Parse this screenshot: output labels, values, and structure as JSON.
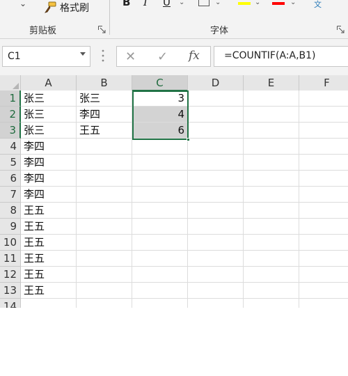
{
  "ribbon": {
    "format_painter_label": "格式刷",
    "clipboard_group_label": "剪贴板",
    "font_group_label": "字体",
    "bold_label": "B",
    "italic_label": "I",
    "underline_label": "U",
    "wen_label": "文",
    "highlight_color": "#ffff00",
    "font_color": "#ff0000"
  },
  "formula_bar": {
    "name_box": "C1",
    "formula": "=COUNTIF(A:A,B1)"
  },
  "sheet": {
    "columns": [
      "A",
      "B",
      "C",
      "D",
      "E",
      "F"
    ],
    "selected_column": "C",
    "rows": [
      {
        "n": "1",
        "A": "张三",
        "B": "张三",
        "C": "3"
      },
      {
        "n": "2",
        "A": "张三",
        "B": "李四",
        "C": "4"
      },
      {
        "n": "3",
        "A": "张三",
        "B": "王五",
        "C": "6"
      },
      {
        "n": "4",
        "A": "李四",
        "B": "",
        "C": ""
      },
      {
        "n": "5",
        "A": "李四",
        "B": "",
        "C": ""
      },
      {
        "n": "6",
        "A": "李四",
        "B": "",
        "C": ""
      },
      {
        "n": "7",
        "A": "李四",
        "B": "",
        "C": ""
      },
      {
        "n": "8",
        "A": "王五",
        "B": "",
        "C": ""
      },
      {
        "n": "9",
        "A": "王五",
        "B": "",
        "C": ""
      },
      {
        "n": "10",
        "A": "王五",
        "B": "",
        "C": ""
      },
      {
        "n": "11",
        "A": "王五",
        "B": "",
        "C": ""
      },
      {
        "n": "12",
        "A": "王五",
        "B": "",
        "C": ""
      },
      {
        "n": "13",
        "A": "王五",
        "B": "",
        "C": ""
      },
      {
        "n": "14",
        "A": "",
        "B": "",
        "C": ""
      }
    ],
    "selection_color": "#217346"
  }
}
